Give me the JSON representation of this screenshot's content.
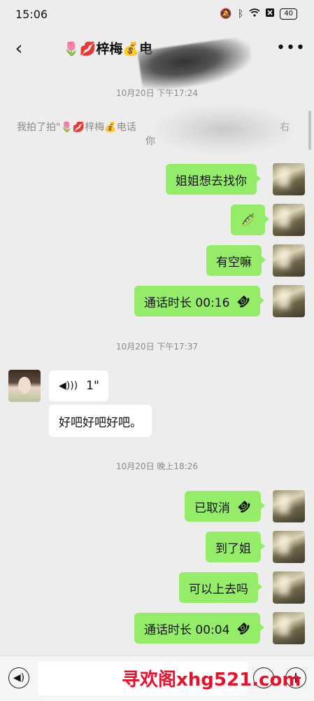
{
  "status": {
    "time": "15:06",
    "battery": "40"
  },
  "header": {
    "title": "🌷💋梓梅💰电"
  },
  "timestamps": [
    "10月20日 下午17:24",
    "10月20日 下午17:37",
    "10月20日 晚上18:26"
  ],
  "system_message": "我拍了拍\"🌷💋梓梅💰电话",
  "system_message_tail": "右",
  "system_message_line2": "你",
  "messages_right_1": [
    {
      "text": "姐姐想去找你"
    },
    {
      "text": "🫛"
    },
    {
      "text": "有空嘛"
    },
    {
      "text": "通话时长 00:16",
      "call": true
    }
  ],
  "voice_message": {
    "duration": "1\"",
    "wave_icon": "sound-wave-icon"
  },
  "left_text": "好吧好吧好吧。",
  "messages_right_2": [
    {
      "text": "已取消",
      "call": true
    },
    {
      "text": "到了姐"
    },
    {
      "text": "可以上去吗"
    },
    {
      "text": "通话时长 00:04",
      "call": true
    }
  ],
  "input": {
    "placeholder": ""
  },
  "watermark": "寻欢阁xhg521.com",
  "colors": {
    "bubble_right": "#95ec69",
    "background": "#ededed"
  }
}
